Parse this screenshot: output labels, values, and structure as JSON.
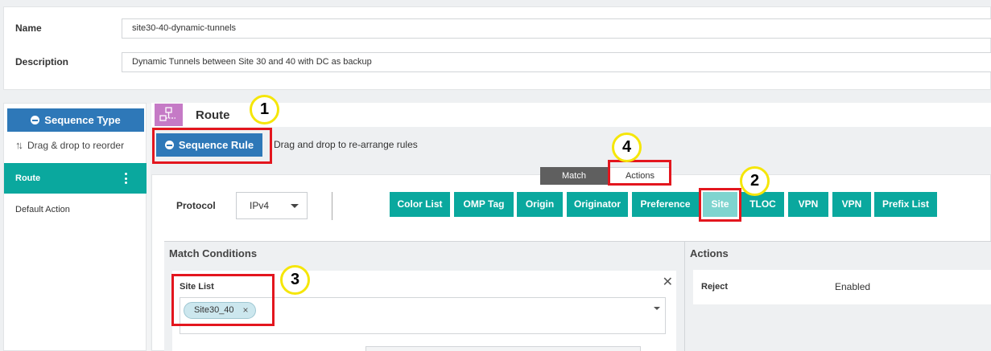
{
  "form": {
    "name_label": "Name",
    "name_value": "site30-40-dynamic-tunnels",
    "description_label": "Description",
    "description_value": "Dynamic Tunnels between Site 30 and 40 with DC as backup"
  },
  "sidebar": {
    "sequence_type_label": "Sequence Type",
    "reorder_hint": "Drag & drop to reorder",
    "items": [
      {
        "label": "Route",
        "active": true
      },
      {
        "label": "Default Action",
        "active": false
      }
    ]
  },
  "route": {
    "title": "Route",
    "sequence_rule_label": "Sequence Rule",
    "rule_hint": "Drag and drop to re-arrange rules"
  },
  "tabs": {
    "match": "Match",
    "actions": "Actions",
    "selected": "Match"
  },
  "protocol": {
    "label": "Protocol",
    "value": "IPv4"
  },
  "match_buttons": [
    "Color List",
    "OMP Tag",
    "Origin",
    "Originator",
    "Preference",
    "Site",
    "TLOC",
    "VPN",
    "VPN",
    "Prefix List"
  ],
  "active_match_button": "Site",
  "match_conditions": {
    "title": "Match Conditions",
    "site_list_label": "Site List",
    "site_list_tags": [
      "Site30_40"
    ]
  },
  "actions_panel": {
    "title": "Actions",
    "rows": [
      {
        "label": "Reject",
        "value": "Enabled"
      }
    ]
  },
  "annotations": [
    "1",
    "2",
    "3",
    "4"
  ],
  "colors": {
    "primary_blue": "#2e78b8",
    "teal": "#0aa89e",
    "teal_active": "#7fd4cf",
    "highlight_red": "#e3161e",
    "marker_yellow": "#f5e609",
    "route_icon": "#c57ac6"
  }
}
